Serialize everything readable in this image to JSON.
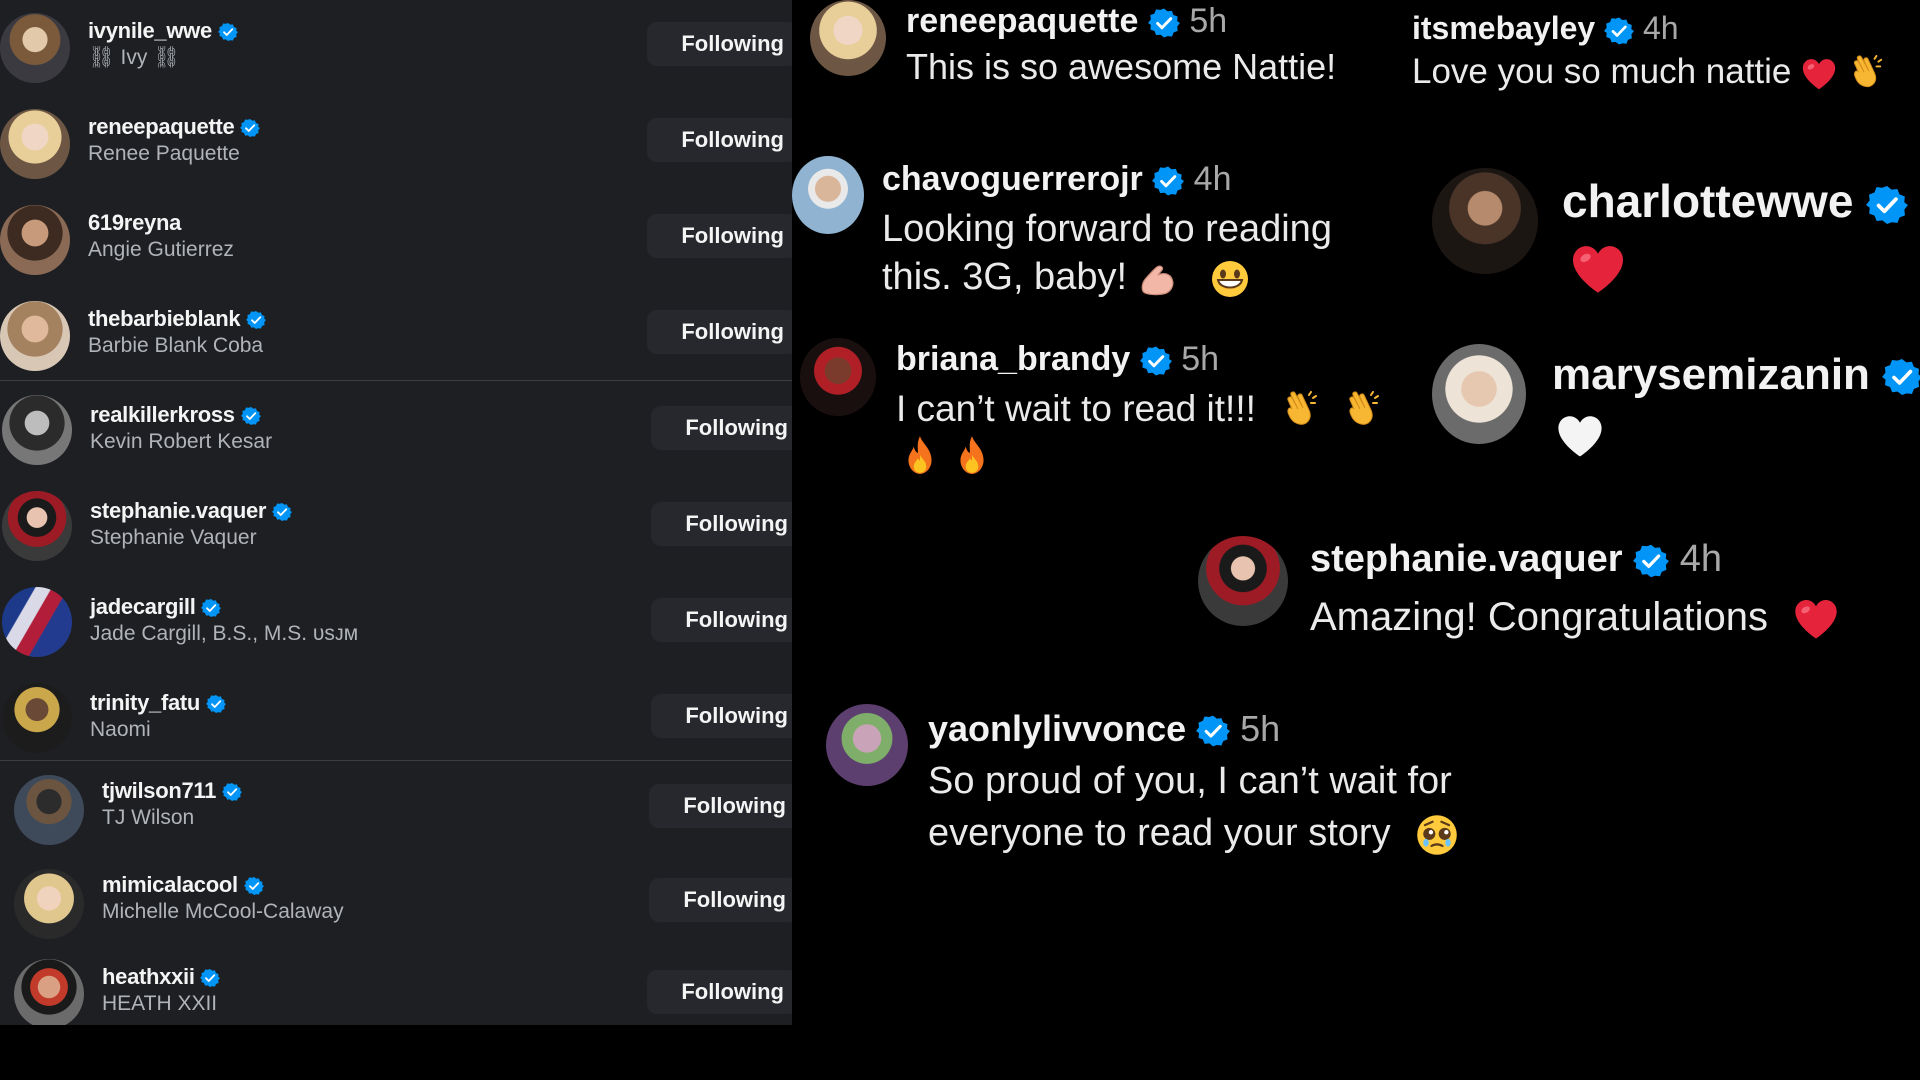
{
  "following": [
    {
      "username": "ivynile_wwe",
      "full_name": "⛓ Ivy ⛓",
      "button": "Following"
    },
    {
      "username": "reneepaquette",
      "full_name": "Renee Paquette",
      "button": "Following"
    },
    {
      "username": "619reyna",
      "full_name": "Angie Gutierrez",
      "button": "Following"
    },
    {
      "username": "thebarbieblank",
      "full_name": "Barbie Blank Coba",
      "button": "Following"
    },
    {
      "username": "realkillerkross",
      "full_name": "Kevin Robert Kesar",
      "button": "Following"
    },
    {
      "username": "stephanie.vaquer",
      "full_name": "Stephanie Vaquer",
      "button": "Following"
    },
    {
      "username": "jadecargill",
      "full_name": "Jade Cargill, B.S., M.S. ᴜsᴊᴍ",
      "button": "Following"
    },
    {
      "username": "trinity_fatu",
      "full_name": "Naomi",
      "button": "Following"
    },
    {
      "username": "tjwilson711",
      "full_name": "TJ Wilson",
      "button": "Following"
    },
    {
      "username": "mimicalacool",
      "full_name": "Michelle McCool-Calaway",
      "button": "Following"
    },
    {
      "username": "heathxxii",
      "full_name": "HEATH XXII",
      "button": "Following"
    }
  ],
  "comments": [
    {
      "username": "reneepaquette",
      "time": "5h",
      "text": "This is so awesome Nattie!",
      "text2": ""
    },
    {
      "username": "itsmebayley",
      "time": "4h",
      "text": "Love you so much nattie",
      "text2": ""
    },
    {
      "username": "chavoguerrerojr",
      "time": "4h",
      "text": "Looking forward to reading",
      "text2": "this. 3G, baby!"
    },
    {
      "username": "charlottewwe",
      "time": "",
      "text": "",
      "text2": ""
    },
    {
      "username": "briana_brandy",
      "time": "5h",
      "text": "I can’t wait to read it!!!",
      "text2": ""
    },
    {
      "username": "marysemizanin",
      "time": "",
      "text": "",
      "text2": ""
    },
    {
      "username": "stephanie.vaquer",
      "time": "4h",
      "text": "Amazing! Congratulations",
      "text2": ""
    },
    {
      "username": "yaonlylivvonce",
      "time": "5h",
      "text": "So proud of you, I can’t wait for",
      "text2": "everyone to read your story"
    }
  ],
  "icons": [
    "verified-badge-icon",
    "red-heart-icon",
    "white-heart-icon",
    "clapping-hands-icon",
    "flexed-biceps-icon",
    "grinning-face-icon",
    "fire-icon",
    "pleading-face-icon"
  ],
  "colors": {
    "verified": "#0095f6",
    "panel_bg": "#1d1f23",
    "button_bg": "#26282d",
    "page_bg": "#000000",
    "heart": "#e5243b"
  }
}
